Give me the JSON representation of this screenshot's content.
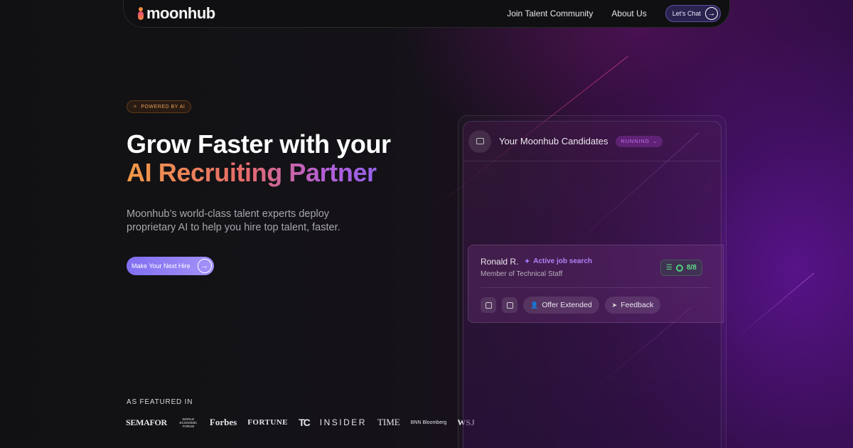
{
  "nav": {
    "logo": "moonhub",
    "links": [
      "Join Talent Community",
      "About Us"
    ],
    "chat_label": "Let's Chat"
  },
  "hero": {
    "badge": "POWERED BY AI",
    "title_line1": "Grow Faster with your",
    "title_line2": "AI Recruiting Partner",
    "subtitle": "Moonhub’s world-class talent experts deploy proprietary AI to help you hire top talent, faster.",
    "cta_label": "Make Your Next Hire"
  },
  "featured": {
    "title": "AS FEATURED IN",
    "logos": [
      "SEMAFOR",
      "WORLD ECONOMIC FORUM",
      "Forbes",
      "FORTUNE",
      "TC",
      "INSIDER",
      "TIME",
      "BNN Bloomberg",
      "WSJ"
    ]
  },
  "panel": {
    "title": "Your Moonhub Candidates",
    "status": "RUNNING",
    "candidate": {
      "name": "Ronald R.",
      "tag": "Active job search",
      "role": "Member of Technical Staff",
      "score": "8/8",
      "actions": [
        "Offer Extended",
        "Feedback"
      ]
    }
  },
  "colors": {
    "accent_purple": "#8f63f2",
    "accent_orange": "#f19a46",
    "score_green": "#5fdc86"
  }
}
